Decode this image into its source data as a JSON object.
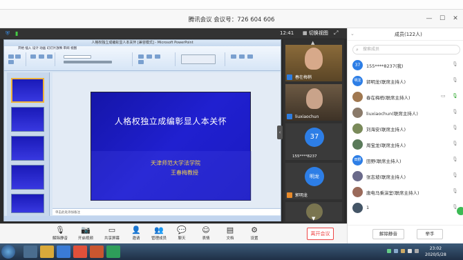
{
  "window": {
    "title": "腾讯会议 会议号：726 604 606",
    "btn_min": "—",
    "btn_max": "☐",
    "btn_close": "✕"
  },
  "share_bar": {
    "time": "12:41",
    "view_label": "切换视图"
  },
  "ppt": {
    "app_title": "人格权独立成编彰显人本关怀 [兼容模式] - Microsoft PowerPoint",
    "tabs": "开始  插入  设计  动画  幻灯片放映  审阅  视图",
    "notes_placeholder": "单击此处添加备注",
    "slide": {
      "title": "人格权独立成编彰显人本关怀",
      "line1": "天津师范大学法学院",
      "line2": "王春梅教授"
    }
  },
  "videos": [
    {
      "name": "春在梅梢"
    },
    {
      "name": "liuxiaochun"
    },
    {
      "name": "155****8237",
      "avatar": "37"
    },
    {
      "name": "郭明龙",
      "avatar": "明龙"
    }
  ],
  "toolbar": {
    "buttons": [
      {
        "label": "解除静音",
        "icon": "mic-off-icon"
      },
      {
        "label": "开启视频",
        "icon": "camera-off-icon"
      },
      {
        "label": "共享屏幕",
        "icon": "screen-share-icon"
      },
      {
        "label": "邀请",
        "icon": "invite-icon"
      },
      {
        "label": "管理成员",
        "icon": "members-icon"
      },
      {
        "label": "聊天",
        "icon": "chat-icon"
      },
      {
        "label": "表情",
        "icon": "emoji-icon"
      },
      {
        "label": "文档",
        "icon": "document-icon"
      },
      {
        "label": "设置",
        "icon": "settings-icon"
      }
    ],
    "leave": "离开会议"
  },
  "members_panel": {
    "title": "成员(122人)",
    "search_placeholder": "搜索成员",
    "members": [
      {
        "avatar": "37",
        "name": "155****8237(我)"
      },
      {
        "avatar": "明龙",
        "name": "郭明龙(联席主持人)"
      },
      {
        "avatar": "",
        "name": "春在梅梢(联席主持人)"
      },
      {
        "avatar": "",
        "name": "liuxiaochun(联席主持人)"
      },
      {
        "avatar": "",
        "name": "刘海安(联席主持人)"
      },
      {
        "avatar": "",
        "name": "周宝龙(联席主持人)"
      },
      {
        "avatar": "田野",
        "name": "田野(联席主持人)"
      },
      {
        "avatar": "",
        "name": "张志坡(联席主持人)"
      },
      {
        "avatar": "",
        "name": "唐电马乘演室(联席主持人)"
      },
      {
        "avatar": "",
        "name": "1"
      }
    ],
    "unmute_all": "解除静音",
    "raise_hand": "举手"
  },
  "taskbar": {
    "time": "23:02",
    "date": "2020/5/28"
  }
}
